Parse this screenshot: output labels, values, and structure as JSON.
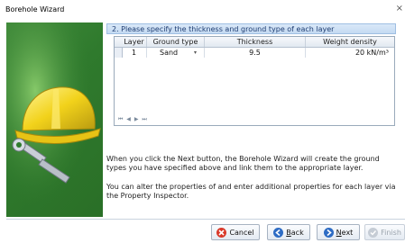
{
  "window": {
    "title": "Borehole Wizard",
    "close_glyph": "×"
  },
  "step_header": "2. Please specify the thickness and ground type of each layer",
  "grid": {
    "headers": [
      "Layer",
      "Ground type",
      "Thickness",
      "Weight density"
    ],
    "rows": [
      {
        "layer": "1",
        "ground_type": "Sand",
        "thickness": "9.5",
        "weight_density": "20 kN/m³"
      }
    ],
    "navigator": "⏮ ◀ ▶ ⏭"
  },
  "description": {
    "para1": "When you click the Next button, the Borehole Wizard will create the ground types you have specified above and link them to the appropriate layer.",
    "para2": "You can alter the properties of and enter additional properties for each layer via the Property Inspector."
  },
  "buttons": {
    "cancel": {
      "label": "Cancel",
      "icon": "cancel-icon"
    },
    "back": {
      "mnemonic": "B",
      "rest": "ack",
      "icon": "back-arrow-icon"
    },
    "next": {
      "mnemonic": "N",
      "rest": "ext",
      "icon": "next-arrow-icon"
    },
    "finish": {
      "label": "Finish",
      "icon": "finish-icon"
    }
  },
  "colors": {
    "accent": "#1f5fb5",
    "panel_green": "#2f7a2d",
    "helmet_yellow": "#f2d21b"
  }
}
